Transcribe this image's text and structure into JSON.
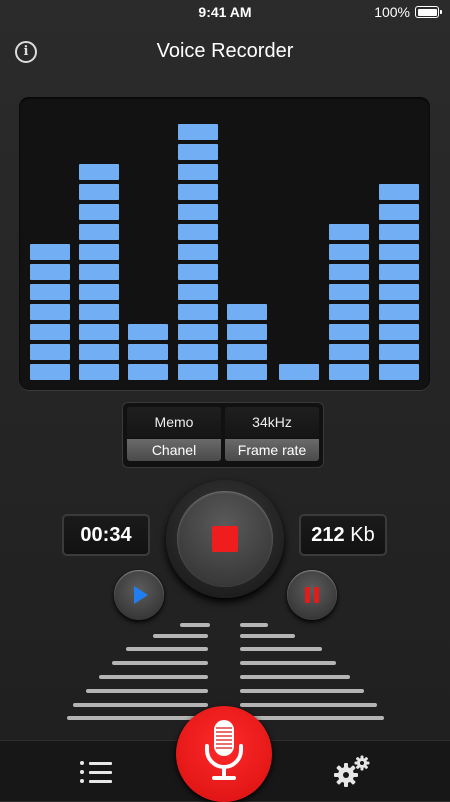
{
  "status_bar": {
    "time": "9:41 AM",
    "battery": "100%"
  },
  "header": {
    "title": "Voice Recorder",
    "info_icon": "info-icon"
  },
  "equalizer": {
    "color": "#72aef4",
    "levels": [
      7,
      11,
      3,
      13,
      4,
      1,
      8,
      10
    ]
  },
  "selector": {
    "channel": {
      "value": "Memo",
      "label": "Chanel"
    },
    "frame_rate": {
      "value": "34kHz",
      "label": "Frame rate"
    }
  },
  "recording": {
    "elapsed": "00:34",
    "size_value": "212",
    "size_unit": "Kb"
  },
  "controls": {
    "stop_icon": "stop-icon",
    "play_icon": "play-icon",
    "pause_icon": "pause-icon",
    "record_icon": "microphone-icon"
  },
  "colors": {
    "accent_red": "#ef1d1d",
    "accent_blue": "#1f7ef0"
  },
  "bottom_bar": {
    "list_icon": "list-icon",
    "settings_icon": "gears-icon"
  }
}
